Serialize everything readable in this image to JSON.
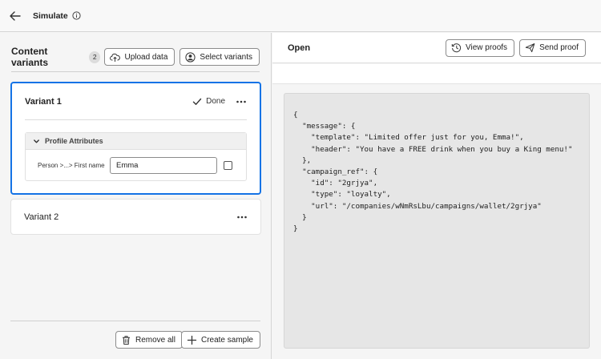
{
  "topbar": {
    "title": "Simulate",
    "back_icon": "arrow-left-icon",
    "info_icon": "info-icon"
  },
  "left_panel": {
    "title": "Content variants",
    "count": "2",
    "upload_label": "Upload data",
    "select_label": "Select variants",
    "variants": [
      {
        "name": "Variant 1",
        "status": "Done",
        "selected": true,
        "section_title": "Profile Attributes",
        "attribute_label": "Person >...> First name",
        "attribute_value": "Emma"
      },
      {
        "name": "Variant 2"
      }
    ],
    "remove_all_label": "Remove all",
    "create_sample_label": "Create sample"
  },
  "right_panel": {
    "title": "Open",
    "view_proofs_label": "View proofs",
    "send_proof_label": "Send proof",
    "code": "{\n  \"message\": {\n    \"template\": \"Limited offer just for you, Emma!\",\n    \"header\": \"You have a FREE drink when you buy a King menu!\"\n  },\n  \"campaign_ref\": {\n    \"id\": \"2grjya\",\n    \"type\": \"loyalty\",\n    \"url\": \"/companies/wNmRsLbu/campaigns/wallet/2grjya\"\n  }\n}"
  },
  "colors": {
    "accent": "#1473e6",
    "panel_bg": "#f5f5f5",
    "code_bg": "#e6e6e6"
  }
}
